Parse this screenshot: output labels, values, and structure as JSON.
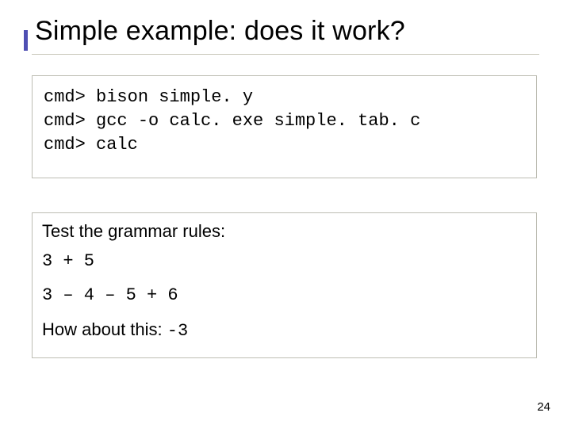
{
  "title": "Simple example: does it work?",
  "code": {
    "line1": "cmd> bison simple. y",
    "line2": "cmd> gcc -o calc. exe simple. tab. c",
    "line3": "cmd> calc"
  },
  "test": {
    "heading": "Test the grammar rules:",
    "expr1": "3 + 5",
    "expr2": "3 – 4 – 5 + 6",
    "final_prefix": "How about this: ",
    "final_code": "-3"
  },
  "page_number": "24"
}
